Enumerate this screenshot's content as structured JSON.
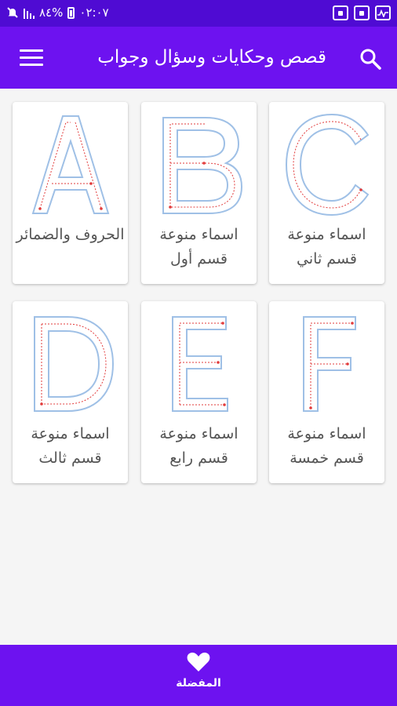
{
  "status": {
    "time_text": "٠٢:٠٧",
    "battery_text": "%٨٤"
  },
  "app_bar": {
    "title": "قصص وحكايات وسؤال وجواب"
  },
  "cards": [
    {
      "letter": "A",
      "label": "الحروف والضمائر"
    },
    {
      "letter": "B",
      "label": "اسماء منوعة قسم أول"
    },
    {
      "letter": "C",
      "label": "اسماء منوعة قسم ثاني"
    },
    {
      "letter": "D",
      "label": "اسماء منوعة قسم ثالث"
    },
    {
      "letter": "E",
      "label": "اسماء منوعة قسم رابع"
    },
    {
      "letter": "F",
      "label": "اسماء منوعة قسم خمسة"
    }
  ],
  "bottom_nav": {
    "favorites_label": "المفضلة"
  },
  "colors": {
    "status_bar": "#4f0bd3",
    "app_bar": "#6d12f0",
    "letter_outline": "#9fc0e6",
    "trace_line": "#e23b3b"
  },
  "icons": [
    "search-icon",
    "menu-icon",
    "heart-icon"
  ]
}
